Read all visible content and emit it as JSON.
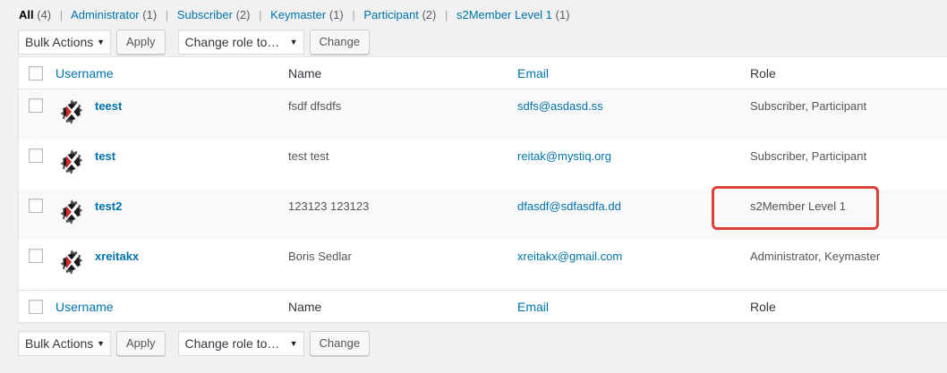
{
  "filters": [
    {
      "label": "All",
      "count": "(4)",
      "current": true
    },
    {
      "label": "Administrator",
      "count": "(1)"
    },
    {
      "label": "Subscriber",
      "count": "(2)"
    },
    {
      "label": "Keymaster",
      "count": "(1)"
    },
    {
      "label": "Participant",
      "count": "(2)"
    },
    {
      "label": "s2Member Level 1",
      "count": "(1)"
    }
  ],
  "separator": "|",
  "actions": {
    "bulk_label": "Bulk Actions",
    "apply_label": "Apply",
    "role_label": "Change role to…",
    "change_label": "Change",
    "arrow_glyph": "▼"
  },
  "columns": {
    "username": "Username",
    "name": "Name",
    "email": "Email",
    "role": "Role"
  },
  "users": [
    {
      "username": "teest",
      "name": "fsdf dfsdfs",
      "email": "sdfs@asdasd.ss",
      "role": "Subscriber, Participant"
    },
    {
      "username": "test",
      "name": "test test",
      "email": "reitak@mystiq.org",
      "role": "Subscriber, Participant"
    },
    {
      "username": "test2",
      "name": "123123 123123",
      "email": "dfasdf@sdfasdfa.dd",
      "role": "s2Member Level 1"
    },
    {
      "username": "xreitakx",
      "name": "Boris Sedlar",
      "email": "xreitakx@gmail.com",
      "role": "Administrator, Keymaster"
    }
  ],
  "colors": {
    "link": "#0073aa",
    "highlight": "#d9403a"
  },
  "avatar_icon": "gear-x-avatar-icon"
}
